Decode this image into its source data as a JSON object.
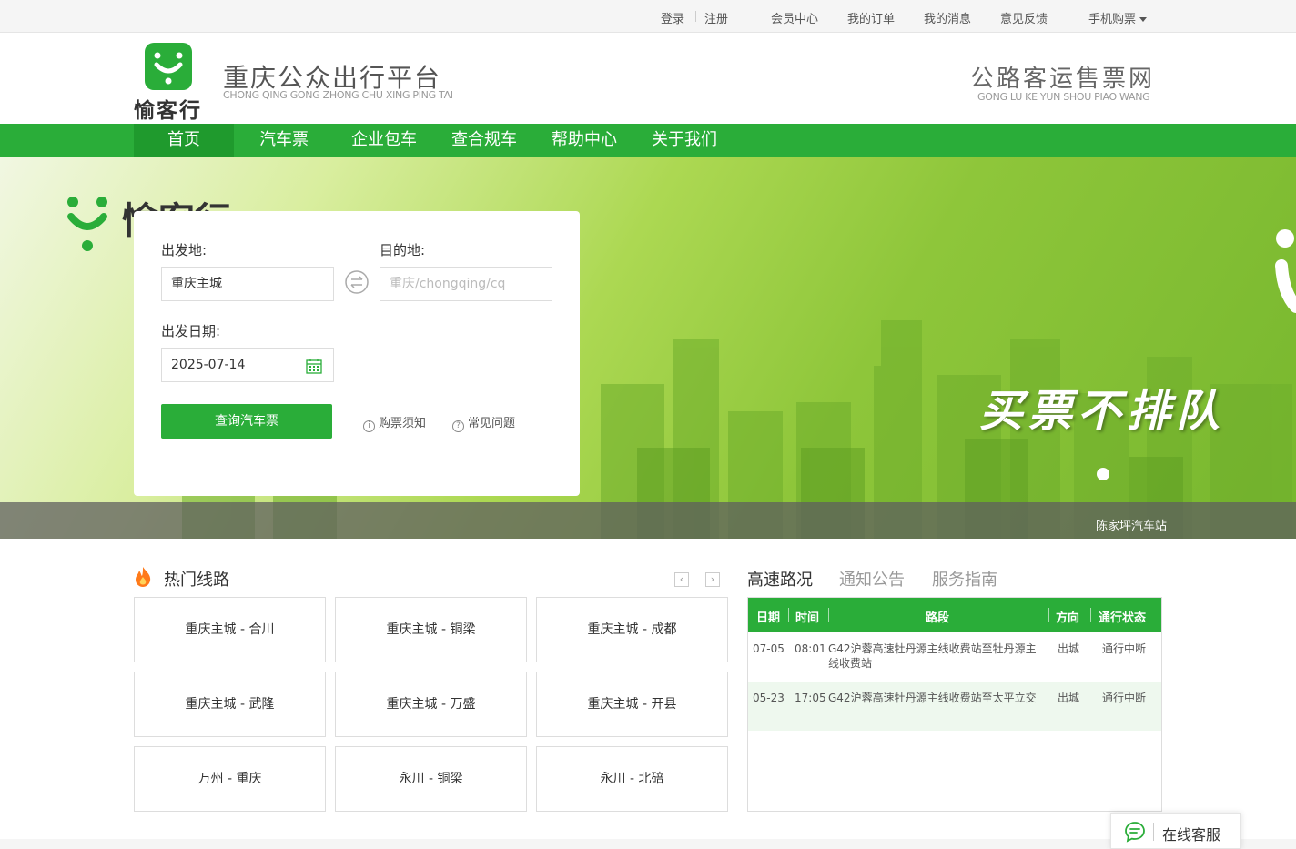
{
  "topbar": {
    "login": "登录",
    "register": "注册",
    "member_center": "会员中心",
    "my_orders": "我的订单",
    "my_messages": "我的消息",
    "feedback": "意见反馈",
    "mobile_purchase": "手机购票"
  },
  "header": {
    "logo_text": "愉客行",
    "site_title": "重庆公众出行平台",
    "site_subtitle": "CHONG QING GONG ZHONG CHU XING PING TAI",
    "right_title": "公路客运售票网",
    "right_subtitle": "GONG LU KE YUN SHOU PIAO WANG"
  },
  "nav": {
    "items": [
      {
        "label": "首页"
      },
      {
        "label": "汽车票"
      },
      {
        "label": "企业包车"
      },
      {
        "label": "查合规车"
      },
      {
        "label": "帮助中心"
      },
      {
        "label": "关于我们"
      }
    ]
  },
  "banner": {
    "slogan": "买票不排队",
    "caption": "陈家坪汽车站",
    "brand_mark": "愉客行"
  },
  "search": {
    "from_label": "出发地:",
    "from_value": "重庆主城",
    "to_label": "目的地:",
    "to_placeholder": "重庆/chongqing/cq",
    "date_label": "出发日期:",
    "date_value": "2025-07-14",
    "search_button": "查询汽车票",
    "notice_link": "购票须知",
    "faq_link": "常见问题"
  },
  "hot_routes": {
    "title": "热门线路",
    "prev": "‹",
    "next": "›",
    "routes": [
      "重庆主城 - 合川",
      "重庆主城 - 铜梁",
      "重庆主城 - 成都",
      "重庆主城 - 武隆",
      "重庆主城 - 万盛",
      "重庆主城 - 开县",
      "万州 - 重庆",
      "永川 - 铜梁",
      "永川 - 北碚"
    ]
  },
  "info_tabs": {
    "tabs": [
      "高速路况",
      "通知公告",
      "服务指南"
    ]
  },
  "traffic": {
    "headers": {
      "date": "日期",
      "time": "时间",
      "road": "路段",
      "direction": "方向",
      "status": "通行状态"
    },
    "rows": [
      {
        "date": "07-05",
        "time": "08:01",
        "road": "G42沪蓉高速牡丹源主线收费站至牡丹源主线收费站",
        "direction": "出城",
        "status": "通行中断"
      },
      {
        "date": "05-23",
        "time": "17:05",
        "road": "G42沪蓉高速牡丹源主线收费站至太平立交",
        "direction": "出城",
        "status": "通行中断"
      }
    ]
  },
  "service": {
    "label": "在线客服"
  },
  "colors": {
    "brand_green": "#2aad39",
    "nav_active": "#1f9a2d"
  }
}
